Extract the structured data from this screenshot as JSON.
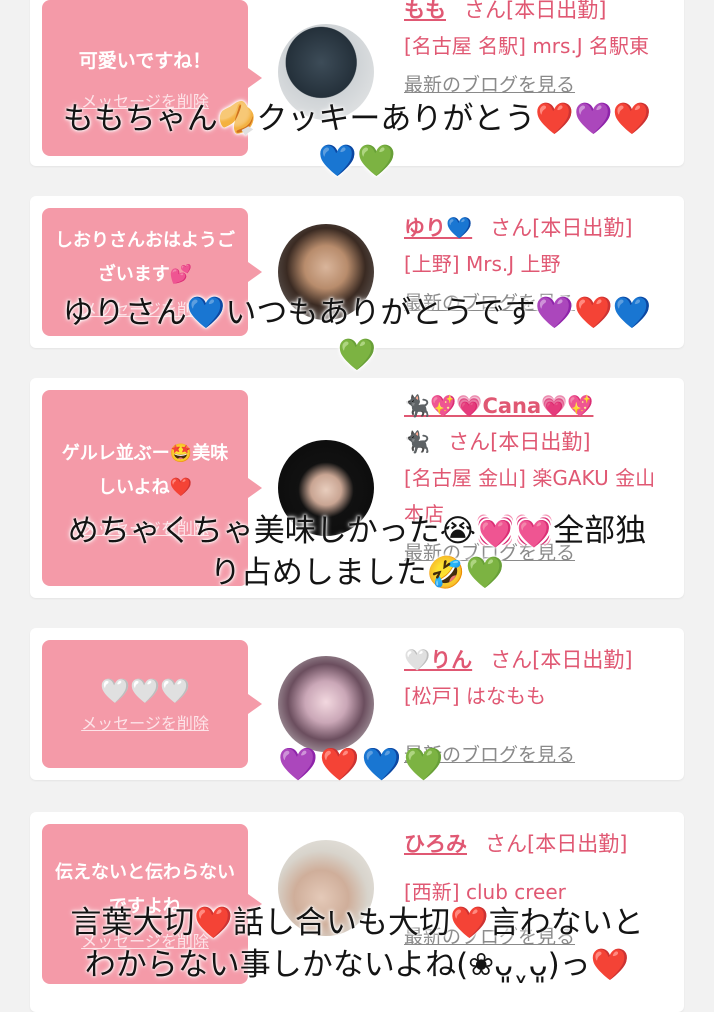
{
  "cards": [
    {
      "message": "可愛いですね！",
      "delete_label": "メッセージを削除",
      "name": "もも",
      "san_label": "さん[本日出勤]",
      "store": "[名古屋 名駅] mrs.J 名駅東",
      "blog_label": "最新のブログを見る"
    },
    {
      "message": "しおりさんおはようございます💕",
      "delete_label": "メッセージを削除",
      "name": "ゆり💙",
      "san_label": "さん[本日出勤]",
      "store": "[上野] Mrs.J 上野",
      "blog_label": "最新のブログを見る"
    },
    {
      "message": "ゲルレ並ぶー🤩美味しいよね❤️",
      "delete_label": "メッセージを削除",
      "name": "🐈‍⬛💖💗Cana💗💖",
      "name2": "🐈‍⬛",
      "san_label": "さん[本日出勤]",
      "store": "[名古屋 金山] 楽GAKU 金山本店",
      "blog_label": "最新のブログを見る"
    },
    {
      "message": "🤍🤍🤍",
      "delete_label": "メッセージを削除",
      "name": "🤍りん",
      "san_label": "さん[本日出勤]",
      "store": "[松戸] はなもも",
      "blog_label": "最新のブログを見る"
    },
    {
      "message": "伝えないと伝わらないですよね",
      "delete_label": "メッセージを削除",
      "name": "ひろみ",
      "san_label": "さん[本日出勤]",
      "store": "[西新] club creer",
      "blog_label": "最新のブログを見る"
    }
  ],
  "overlays": [
    "ももちゃん🥠クッキーありがとう❤️💜❤️\n💙💚",
    "ゆりさん💙いつもありがとうです💜❤️💙\n💚",
    "めちゃくちゃ美味しかった😭💓💓全部独\nり占めしました🤣💚",
    "💜❤️💙💚",
    "言葉大切❤️話し合いも大切❤️言わないと\nわからない事しかないよね(❀ᴗ͈ˬᴗ͈)っ❤️"
  ],
  "colors": {
    "bubble": "#f49aa8",
    "accent": "#e05873",
    "background": "#f2f2f2"
  }
}
